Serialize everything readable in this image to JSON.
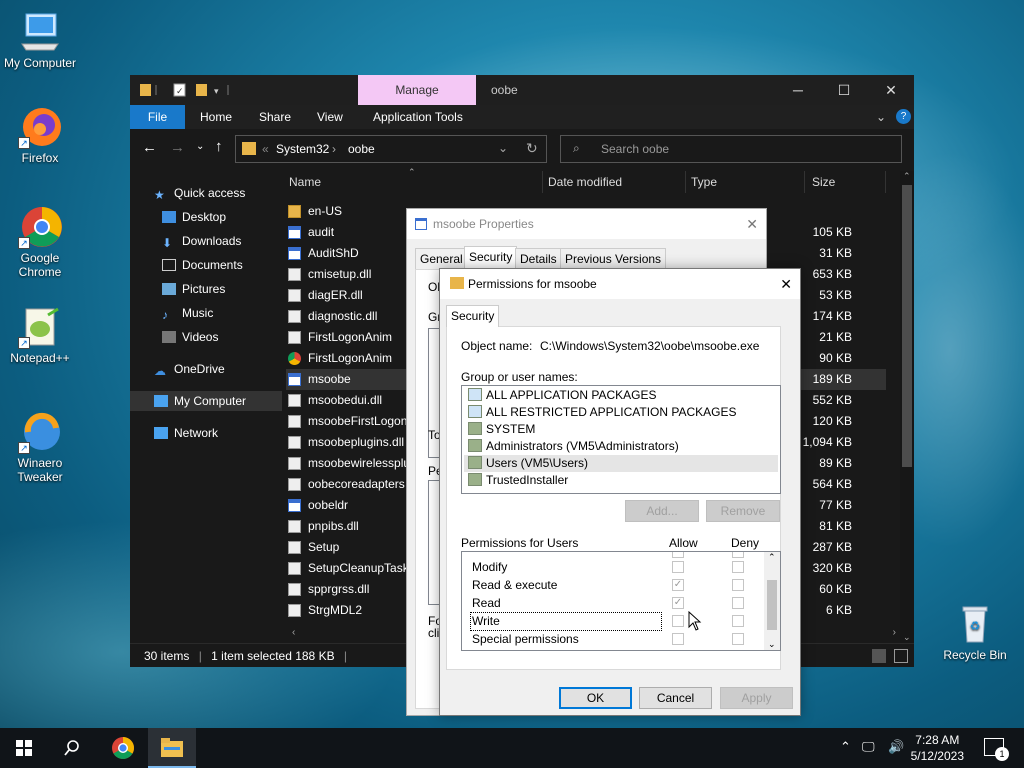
{
  "desktop": {
    "icons": [
      {
        "label": "My Computer"
      },
      {
        "label": "Firefox"
      },
      {
        "label": "Google Chrome"
      },
      {
        "label": "Notepad++"
      },
      {
        "label": "Winaero Tweaker"
      },
      {
        "label": "Recycle Bin"
      }
    ]
  },
  "explorer": {
    "manage_tab": "Manage",
    "title": "oobe",
    "ribbon": {
      "file": "File",
      "home": "Home",
      "share": "Share",
      "view": "View",
      "app_tools": "Application Tools"
    },
    "address": {
      "sep": "«",
      "crumb1": "System32",
      "crumb2": "oobe"
    },
    "search_placeholder": "Search oobe",
    "nav": {
      "quick_access": "Quick access",
      "desktop": "Desktop",
      "downloads": "Downloads",
      "documents": "Documents",
      "pictures": "Pictures",
      "music": "Music",
      "videos": "Videos",
      "onedrive": "OneDrive",
      "my_computer": "My Computer",
      "network": "Network"
    },
    "columns": {
      "name": "Name",
      "date": "Date modified",
      "type": "Type",
      "size": "Size"
    },
    "files": [
      {
        "name": "en-US",
        "size": "",
        "icon": "folder"
      },
      {
        "name": "audit",
        "size": "105 KB",
        "icon": "blue"
      },
      {
        "name": "AuditShD",
        "size": "31 KB",
        "icon": "blue"
      },
      {
        "name": "cmisetup.dll",
        "size": "653 KB",
        "icon": "dll"
      },
      {
        "name": "diagER.dll",
        "size": "53 KB",
        "icon": "dll"
      },
      {
        "name": "diagnostic.dll",
        "size": "174 KB",
        "icon": "dll"
      },
      {
        "name": "FirstLogonAnim",
        "size": "21 KB",
        "icon": "dll"
      },
      {
        "name": "FirstLogonAnim",
        "size": "90 KB",
        "icon": "chrome"
      },
      {
        "name": "msoobe",
        "size": "189 KB",
        "icon": "blue"
      },
      {
        "name": "msoobedui.dll",
        "size": "552 KB",
        "icon": "dll"
      },
      {
        "name": "msoobeFirstLogon",
        "size": "120 KB",
        "icon": "dll"
      },
      {
        "name": "msoobeplugins.dll",
        "size": "1,094 KB",
        "icon": "dll"
      },
      {
        "name": "msoobewirelessplu",
        "size": "89 KB",
        "icon": "dll"
      },
      {
        "name": "oobecoreadapters",
        "size": "564 KB",
        "icon": "dll"
      },
      {
        "name": "oobeldr",
        "size": "77 KB",
        "icon": "blue"
      },
      {
        "name": "pnpibs.dll",
        "size": "81 KB",
        "icon": "dll"
      },
      {
        "name": "Setup",
        "size": "287 KB",
        "icon": "setup"
      },
      {
        "name": "SetupCleanupTask",
        "size": "320 KB",
        "icon": "dll"
      },
      {
        "name": "spprgrss.dll",
        "size": "60 KB",
        "icon": "dll"
      },
      {
        "name": "StrgMDL2",
        "size": "6 KB",
        "icon": "dll"
      }
    ],
    "status": {
      "items": "30 items",
      "selected": "1 item selected  188 KB"
    }
  },
  "properties": {
    "title": "msoobe Properties",
    "tabs": {
      "general": "General",
      "security": "Security",
      "details": "Details",
      "previous": "Previous Versions"
    },
    "peek": {
      "ob": "Ob",
      "gro": "Gro",
      "to": "To",
      "pe": "Pe",
      "fo": "Fo",
      "cli": "clic"
    }
  },
  "permissions": {
    "title": "Permissions for msoobe",
    "tab": "Security",
    "object_label": "Object name:",
    "object_value": "C:\\Windows\\System32\\oobe\\msoobe.exe",
    "group_label": "Group or user names:",
    "groups": [
      "ALL APPLICATION PACKAGES",
      "ALL RESTRICTED APPLICATION PACKAGES",
      "SYSTEM",
      "Administrators (VM5\\Administrators)",
      "Users (VM5\\Users)",
      "TrustedInstaller"
    ],
    "add": "Add...",
    "remove": "Remove",
    "perm_for": "Permissions for Users",
    "allow": "Allow",
    "deny": "Deny",
    "perms": [
      {
        "name": "Modify",
        "allow": false
      },
      {
        "name": "Read & execute",
        "allow": true
      },
      {
        "name": "Read",
        "allow": true
      },
      {
        "name": "Write",
        "allow": false
      },
      {
        "name": "Special permissions",
        "allow": false
      }
    ],
    "ok": "OK",
    "cancel": "Cancel",
    "apply": "Apply"
  },
  "taskbar": {
    "time": "7:28 AM",
    "date": "5/12/2023",
    "notif_count": "1"
  }
}
